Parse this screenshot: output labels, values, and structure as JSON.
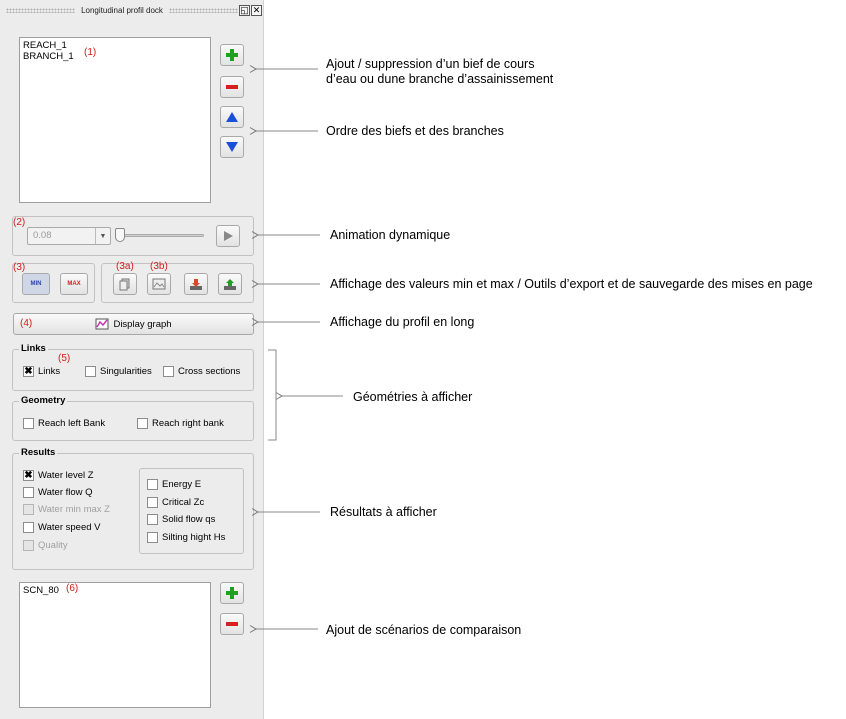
{
  "dock": {
    "title": "Longitudinal profil dock",
    "float_glyph": "◱",
    "close_glyph": "✕"
  },
  "reach_list": {
    "items": [
      "REACH_1",
      "BRANCH_1"
    ],
    "marker": "(1)"
  },
  "animation": {
    "marker": "(2)",
    "combo_value": "0.08",
    "slider_level": 0
  },
  "display_values": {
    "marker": "(3)",
    "min_label": "MIN",
    "max_label": "MAX"
  },
  "export_tools": {
    "marker_a": "(3a)",
    "marker_b": "(3b)"
  },
  "display_graph": {
    "marker": "(4)",
    "label": "Display graph"
  },
  "links_group": {
    "title": "Links",
    "marker": "(5)",
    "items": [
      {
        "label": "Links",
        "checked": true
      },
      {
        "label": "Singularities",
        "checked": false
      },
      {
        "label": "Cross sections",
        "checked": false
      }
    ]
  },
  "geometry_group": {
    "title": "Geometry",
    "items": [
      {
        "label": "Reach left Bank",
        "checked": false
      },
      {
        "label": "Reach right bank",
        "checked": false
      }
    ]
  },
  "results_group": {
    "title": "Results",
    "left": [
      {
        "label": "Water level Z",
        "checked": true,
        "enabled": true
      },
      {
        "label": "Water flow Q",
        "checked": false,
        "enabled": true
      },
      {
        "label": "Water min max Z",
        "checked": false,
        "enabled": false
      },
      {
        "label": "Water speed V",
        "checked": false,
        "enabled": true
      },
      {
        "label": "Quality",
        "checked": false,
        "enabled": false
      }
    ],
    "right": [
      {
        "label": "Energy E",
        "checked": false
      },
      {
        "label": "Critical Zc",
        "checked": false
      },
      {
        "label": "Solid flow qs",
        "checked": false
      },
      {
        "label": "Silting hight Hs",
        "checked": false
      }
    ]
  },
  "scenario_list": {
    "items": [
      "SCN_80"
    ],
    "marker": "(6)"
  },
  "annotations": {
    "add_remove_line1": "Ajout / suppression d’un bief de cours",
    "add_remove_line2": "d’eau ou dune branche d’assainissement",
    "order": "Ordre des biefs et des branches",
    "animation": "Animation dynamique",
    "display_values": "Affichage des valeurs min et max / Outils d’export et de sauvegarde des mises en page",
    "profile": "Affichage du profil en long",
    "geometries": "Géométries à afficher",
    "results": "Résultats à afficher",
    "scenarios": "Ajout de scénarios de comparaison"
  },
  "colors": {
    "add_green": "#1fa11f",
    "remove_red": "#d42020",
    "arrow_blue": "#1a4fd8",
    "marker_red": "#d41a1a"
  }
}
